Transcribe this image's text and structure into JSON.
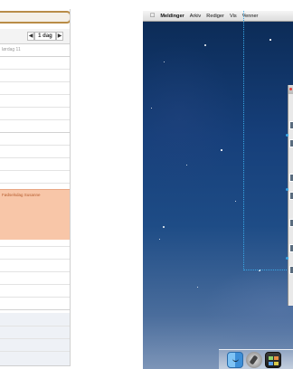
{
  "calendar": {
    "nav": {
      "prev": "◀",
      "view": "1 dag",
      "next": "▶"
    },
    "allday_label": "lørdag 11",
    "event_title": "Fødselsdag Susanne"
  },
  "desktop": {
    "menubar": {
      "apple": "",
      "app_name": "Meldinger",
      "items": [
        "Arkiv",
        "Rediger",
        "Vis",
        "Venner"
      ]
    },
    "dock": {
      "items": [
        "finder-icon",
        "launchpad-icon",
        "mission-control-icon"
      ]
    },
    "colors": {
      "accent_dotted": "#39a7e6",
      "event": "#f8c6a8"
    }
  }
}
